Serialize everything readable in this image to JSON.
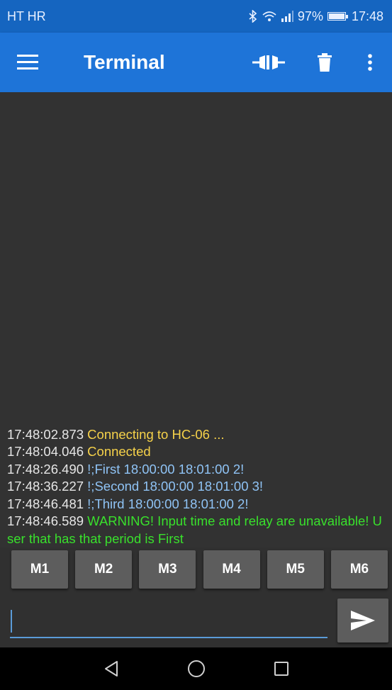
{
  "status_bar": {
    "carrier": "HT HR",
    "battery": "97%",
    "time": "17:48",
    "icons": [
      "bluetooth-icon",
      "wifi-icon",
      "signal-icon",
      "battery-icon"
    ]
  },
  "app_bar": {
    "title": "Terminal",
    "icons": [
      "menu-icon",
      "connect-plug-icon",
      "delete-trash-icon",
      "more-vert-icon"
    ]
  },
  "terminal": {
    "lines": [
      {
        "time": "17:48:02.873",
        "text": "Connecting to HC-06 ...",
        "kind": "status"
      },
      {
        "time": "17:48:04.046",
        "text": "Connected",
        "kind": "status"
      },
      {
        "time": "17:48:26.490",
        "text": "!;First 18:00:00 18:01:00 2!",
        "kind": "send"
      },
      {
        "time": "17:48:36.227",
        "text": "!;Second 18:00:00 18:01:00 3!",
        "kind": "send"
      },
      {
        "time": "17:48:46.481",
        "text": "!;Third 18:00:00 18:01:00 2!",
        "kind": "send"
      },
      {
        "time": "17:48:46.589",
        "text": "WARNING! Input time and relay are unavailable! User that has that period is First",
        "kind": "recv"
      }
    ]
  },
  "macros": [
    "M1",
    "M2",
    "M3",
    "M4",
    "M5",
    "M6"
  ],
  "input": {
    "value": "",
    "placeholder": ""
  },
  "colors": {
    "status_bar": "#1565c0",
    "app_bar": "#1e74d8",
    "terminal_bg": "#323232",
    "status_text": "#f6d24a",
    "sent_text": "#8fc3f5",
    "received_text": "#39e02c",
    "button_bg": "#5d5d5d"
  },
  "nav": [
    "back-icon",
    "home-icon",
    "recents-icon"
  ]
}
